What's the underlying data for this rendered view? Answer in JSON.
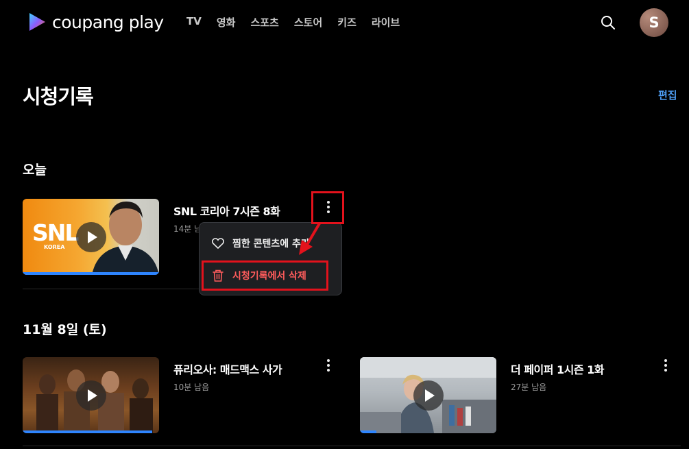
{
  "header": {
    "logo_text": "coupang play",
    "nav": [
      "TV",
      "영화",
      "스포츠",
      "스토어",
      "키즈",
      "라이브"
    ],
    "avatar_initial": "S"
  },
  "page": {
    "title": "시청기록",
    "edit_label": "편집"
  },
  "sections": {
    "today": {
      "title": "오늘",
      "items": [
        {
          "title": "SNL 코리아 7시즌 8화",
          "remaining": "14분 남음",
          "thumb_text": "SNL",
          "thumb_sub": "KOREA",
          "progress": 1.0
        }
      ]
    },
    "nov8": {
      "title": "11월 8일 (토)",
      "items": [
        {
          "title": "퓨리오사: 매드맥스 사가",
          "remaining": "10분 남음",
          "progress": 0.95
        },
        {
          "title": "더 페이퍼 1시즌 1화",
          "remaining": "27분 남음",
          "progress": 0.12
        }
      ]
    }
  },
  "menu": {
    "items": [
      {
        "label": "찜한 콘텐츠에 추가",
        "icon": "heart-icon"
      },
      {
        "label": "시청기록에서 삭제",
        "icon": "trash-icon"
      }
    ]
  },
  "colors": {
    "accent_blue": "#4c9bf0",
    "progress_blue": "#2e85ff",
    "delete_red": "#ff5c5c",
    "annotation_red": "#e3121c"
  }
}
